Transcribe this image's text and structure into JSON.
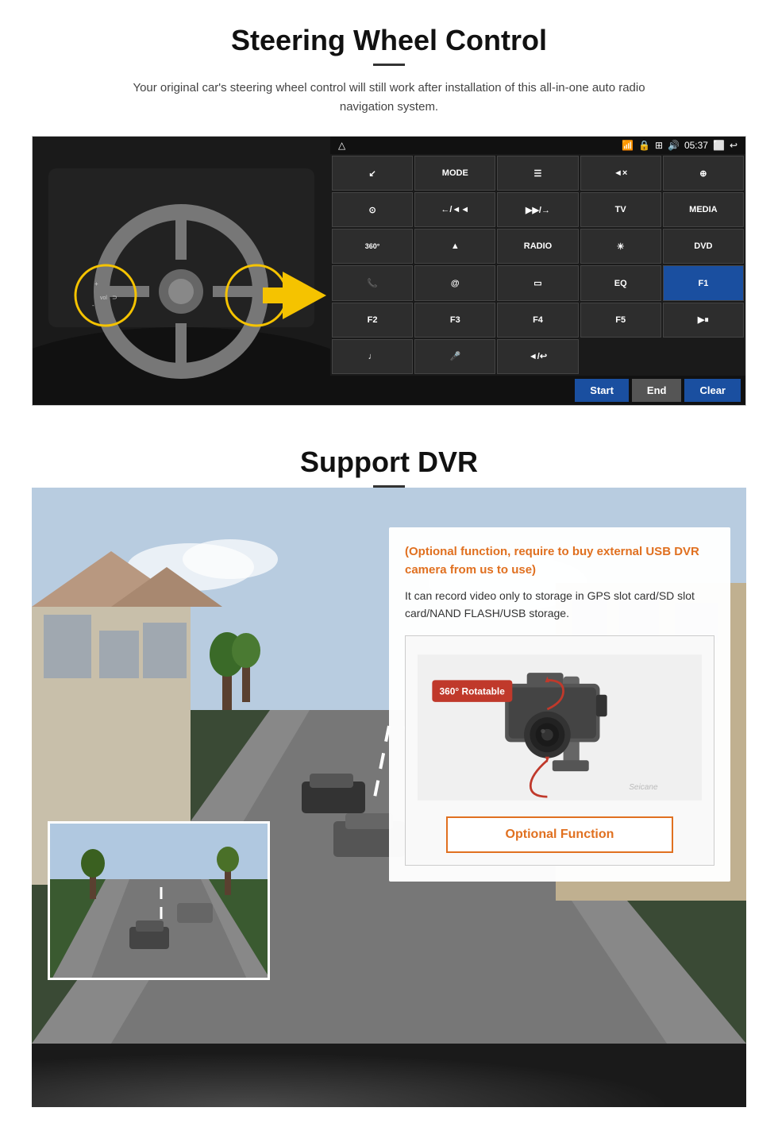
{
  "steering": {
    "title": "Steering Wheel Control",
    "description": "Your original car's steering wheel control will still work after installation of this all-in-one auto radio navigation system.",
    "status_bar": {
      "wifi_icon": "wifi",
      "lock_icon": "🔒",
      "grid_icon": "⊞",
      "sound_icon": "🔊",
      "time": "05:37",
      "window_icon": "⬜",
      "back_icon": "↩"
    },
    "buttons": [
      {
        "label": "↙",
        "row": 1,
        "col": 1
      },
      {
        "label": "MODE",
        "row": 1,
        "col": 2
      },
      {
        "label": "☰",
        "row": 1,
        "col": 3
      },
      {
        "label": "◄×",
        "row": 1,
        "col": 4
      },
      {
        "label": "⊕",
        "row": 1,
        "col": 5
      },
      {
        "label": "⊙",
        "row": 2,
        "col": 1
      },
      {
        "label": "←/◄◄",
        "row": 2,
        "col": 2
      },
      {
        "label": "▶▶/→",
        "row": 2,
        "col": 3
      },
      {
        "label": "TV",
        "row": 2,
        "col": 4
      },
      {
        "label": "MEDIA",
        "row": 2,
        "col": 5
      },
      {
        "label": "360",
        "row": 3,
        "col": 1
      },
      {
        "label": "▲",
        "row": 3,
        "col": 2
      },
      {
        "label": "RADIO",
        "row": 3,
        "col": 3
      },
      {
        "label": "☀",
        "row": 3,
        "col": 4
      },
      {
        "label": "DVD",
        "row": 3,
        "col": 5
      },
      {
        "label": "📞",
        "row": 4,
        "col": 1
      },
      {
        "label": "@",
        "row": 4,
        "col": 2
      },
      {
        "label": "▭",
        "row": 4,
        "col": 3
      },
      {
        "label": "EQ",
        "row": 4,
        "col": 4
      },
      {
        "label": "F1",
        "row": 4,
        "col": 5
      },
      {
        "label": "F2",
        "row": 5,
        "col": 1
      },
      {
        "label": "F3",
        "row": 5,
        "col": 2
      },
      {
        "label": "F4",
        "row": 5,
        "col": 3
      },
      {
        "label": "F5",
        "row": 5,
        "col": 4
      },
      {
        "label": "▶⏸",
        "row": 5,
        "col": 5
      },
      {
        "label": "♩",
        "row": 6,
        "col": 1
      },
      {
        "label": "🎤",
        "row": 6,
        "col": 2
      },
      {
        "label": "◄/↩",
        "row": 6,
        "col": 3
      }
    ],
    "bottom_buttons": {
      "start": "Start",
      "end": "End",
      "clear": "Clear"
    }
  },
  "dvr": {
    "title": "Support DVR",
    "optional_text": "(Optional function, require to buy external USB DVR camera from us to use)",
    "description": "It can record video only to storage in GPS slot card/SD slot card/NAND FLASH/USB storage.",
    "badge_360": "360° Rotatable",
    "optional_function": "Optional Function",
    "watermark": "Seicane"
  }
}
